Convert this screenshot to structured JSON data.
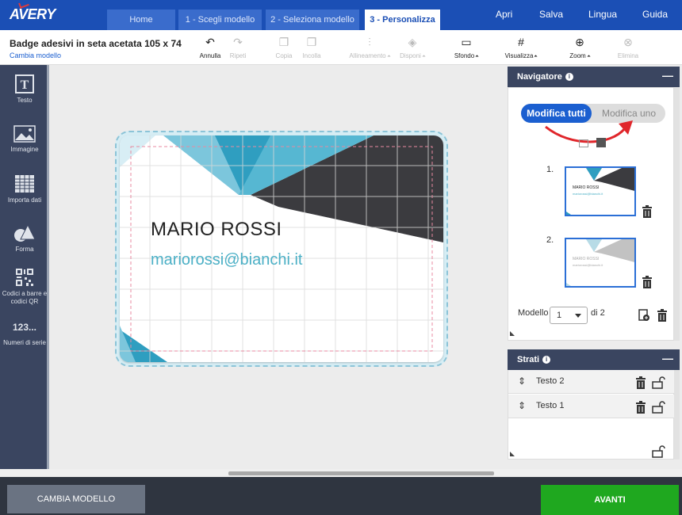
{
  "brand": {
    "logo": "AVERY"
  },
  "tabs": [
    {
      "label": "Home"
    },
    {
      "label": "1 - Scegli modello"
    },
    {
      "label": "2 - Seleziona modello"
    },
    {
      "label": "3 - Personalizza",
      "active": true
    }
  ],
  "top_links": [
    "Apri",
    "Salva",
    "Lingua",
    "Guida"
  ],
  "document": {
    "title": "Badge adesivi in seta acetata 105 x 74",
    "change_link": "Cambia modello"
  },
  "toolbar": {
    "undo": "Annulla",
    "redo": "Ripeti",
    "copy": "Copia",
    "paste": "Incolla",
    "align": "Allineamento",
    "arrange": "Disponi",
    "background": "Sfondo",
    "view": "Visualizza",
    "zoom": "Zoom",
    "delete": "Elimina"
  },
  "sidebar": [
    {
      "label": "Testo",
      "icon": "text-icon"
    },
    {
      "label": "Immagine",
      "icon": "image-icon"
    },
    {
      "label": "Importa dati",
      "icon": "table-icon"
    },
    {
      "label": "Forma",
      "icon": "shapes-icon"
    },
    {
      "label": "Codici a barre e codici QR",
      "icon": "qr-code-icon"
    },
    {
      "label": "Numeri di serie",
      "icon_text": "123..."
    }
  ],
  "card": {
    "name": "MARIO ROSSI",
    "email": "mariorossi@bianchi.it"
  },
  "navigator": {
    "title": "Navigatore",
    "toggle_on": "Modifica tutti",
    "toggle_off": "Modifica uno",
    "thumbnails": [
      {
        "number": "1.",
        "name": "MARIO ROSSI",
        "email": "mariorossi@bianchi.it"
      },
      {
        "number": "2.",
        "name": "MARIO ROSSI",
        "email": "mariorossi@bianchi.it"
      }
    ],
    "model_label": "Modello",
    "model_value": "1",
    "model_of": "di 2"
  },
  "layers": {
    "title": "Strati",
    "items": [
      {
        "label": "Testo 2"
      },
      {
        "label": "Testo 1"
      }
    ]
  },
  "footer": {
    "change_button": "CAMBIA MODELLO",
    "next_button": "AVANTI"
  },
  "colors": {
    "brand_blue": "#1b4fb5",
    "accent_blue": "#1b5fd0",
    "sidebar": "#3a4560",
    "next_green": "#1fa81f",
    "card_teal": "#4cb0c6",
    "card_dark": "#3b3b3f"
  }
}
